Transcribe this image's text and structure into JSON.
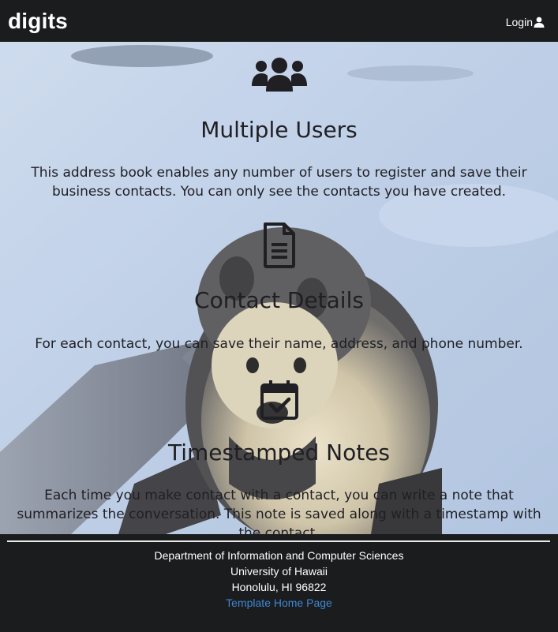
{
  "navbar": {
    "brand": "digits",
    "login_label": "Login"
  },
  "features": [
    {
      "icon": "users-icon",
      "title": "Multiple Users",
      "text": "This address book enables any number of users to register and save their business contacts. You can only see the contacts you have created."
    },
    {
      "icon": "file-document-icon",
      "title": "Contact Details",
      "text": "For each contact, you can save their name, address, and phone number."
    },
    {
      "icon": "calendar-check-icon",
      "title": "Timestamped Notes",
      "text": "Each time you make contact with a contact, you can write a note that summarizes the conversation. This note is saved along with a timestamp with the contact."
    }
  ],
  "footer": {
    "line1": "Department of Information and Computer Sciences",
    "line2": "University of Hawaii",
    "line3": "Honolulu, HI 96822",
    "link_label": "Template Home Page"
  },
  "colors": {
    "navbar_bg": "#1b1c1d",
    "link": "#3d87d6",
    "text_dark": "#1f1f24"
  }
}
